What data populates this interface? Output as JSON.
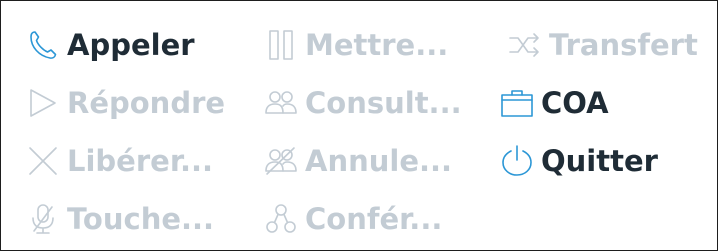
{
  "buttons": {
    "call": {
      "label": "Appeler",
      "enabled": true,
      "icon": "phone-icon"
    },
    "answer": {
      "label": "Répondre",
      "enabled": false,
      "icon": "play-triangle-icon"
    },
    "release": {
      "label": "Libérer...",
      "enabled": false,
      "icon": "cross-icon"
    },
    "keypad": {
      "label": "Touche...",
      "enabled": false,
      "icon": "microphone-icon"
    },
    "hold": {
      "label": "Mettre...",
      "enabled": false,
      "icon": "pause-icon"
    },
    "consult": {
      "label": "Consult...",
      "enabled": false,
      "icon": "two-persons-icon"
    },
    "cancel": {
      "label": "Annule...",
      "enabled": false,
      "icon": "persons-crossed-icon"
    },
    "conference": {
      "label": "Confér...",
      "enabled": false,
      "icon": "conference-icon"
    },
    "transfer": {
      "label": "Transfert",
      "enabled": false,
      "icon": "transfer-arrows-icon"
    },
    "coa": {
      "label": "COA",
      "enabled": true,
      "icon": "briefcase-icon"
    },
    "quit": {
      "label": "Quitter",
      "enabled": true,
      "icon": "power-icon"
    }
  },
  "colors": {
    "enabled_text": "#1f2c36",
    "disabled_text": "#c3ccd4",
    "enabled_icon": "#2c97d6",
    "border": "#1e1e1e"
  }
}
